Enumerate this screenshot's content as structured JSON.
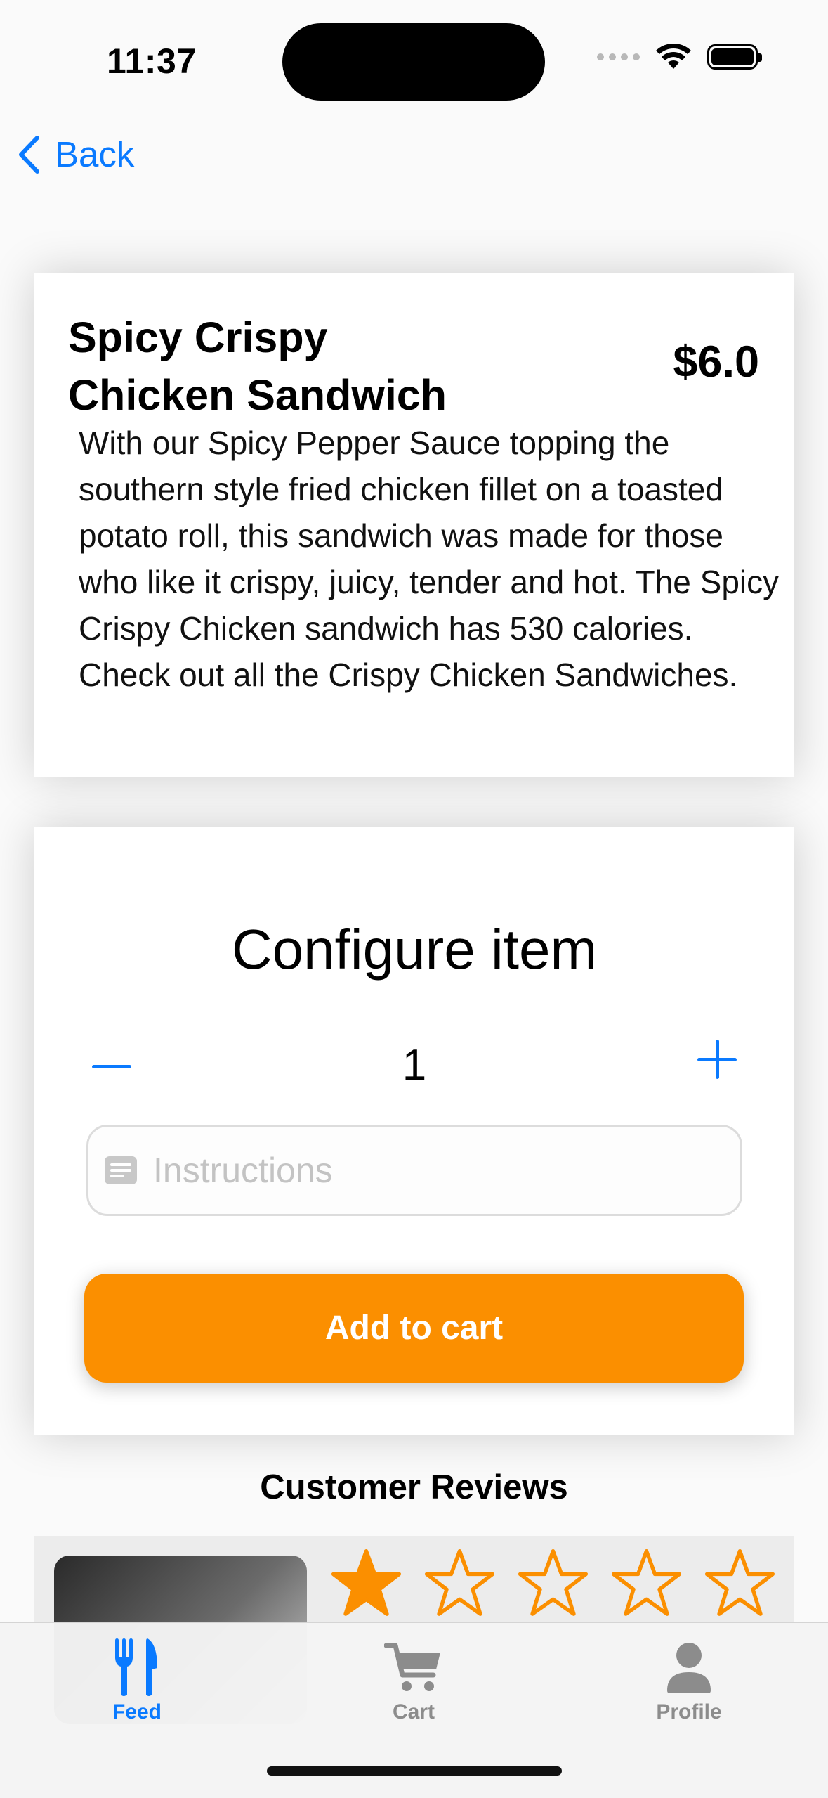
{
  "status_bar": {
    "time": "11:37"
  },
  "nav": {
    "back_label": "Back"
  },
  "item": {
    "title_line1": "Spicy Crispy",
    "title_line2": "Chicken Sandwich",
    "price": "$6.0",
    "description": "With our Spicy Pepper Sauce topping the southern style fried chicken fillet on a toasted potato roll, this sandwich was made for those who like it crispy, juicy, tender and hot. The Spicy Crispy Chicken sandwich has 530 calories. Check out all the Crispy Chicken Sandwiches."
  },
  "configure": {
    "title": "Configure item",
    "quantity": "1",
    "instructions_placeholder": "Instructions",
    "add_to_cart_label": "Add to cart"
  },
  "reviews": {
    "title": "Customer Reviews",
    "first_review_rating": 1,
    "max_rating": 5
  },
  "tabs": [
    {
      "label": "Feed",
      "icon": "fork-knife-icon",
      "selected": true
    },
    {
      "label": "Cart",
      "icon": "cart-icon",
      "selected": false
    },
    {
      "label": "Profile",
      "icon": "person-icon",
      "selected": false
    }
  ],
  "colors": {
    "accent": "#0a7aff",
    "button": "#fb8f00",
    "star": "#fb8f00",
    "tab_inactive": "#8c8c8c"
  }
}
